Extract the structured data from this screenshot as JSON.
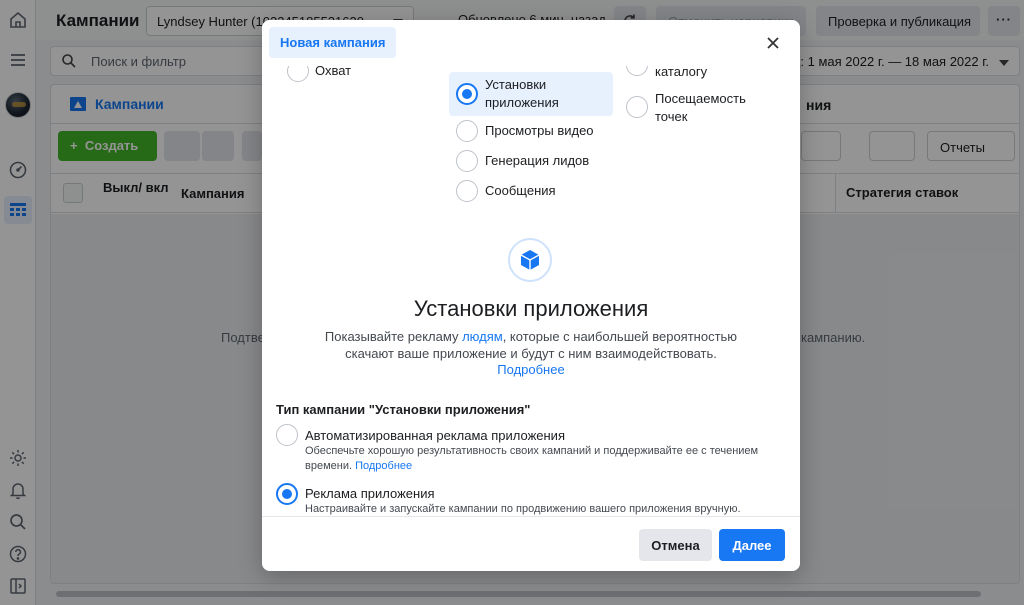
{
  "topbar": {
    "title": "Кампании",
    "account": "Lyndsey Hunter (102345185521630",
    "updated": "Обновлено 6 мин. назад",
    "discard_label": "Отменить черновики",
    "publish_label": "Проверка и публикация",
    "more_label": "···"
  },
  "search": {
    "placeholder": "Поиск и фильтр",
    "date_range": "ц: 1 мая 2022 г. — 18 мая 2022 г."
  },
  "panel": {
    "tab_campaigns": "Кампании",
    "tab_right": "ния",
    "create_label": "Создать",
    "reports_label": "Отчеты",
    "col_onoff": "Выкл/ вкл",
    "col_campaign": "Кампания",
    "col_bid": "Стратегия ставок",
    "empty_left": "Подтве",
    "empty_right": "кампанию."
  },
  "modal": {
    "chip": "Новая кампания",
    "objectives": {
      "reach": "Охват",
      "app_installs": "Установки приложения",
      "video_views": "Просмотры видео",
      "lead_gen": "Генерация лидов",
      "messages": "Сообщения",
      "catalog": "каталогу",
      "store_traffic": "Посещаемость точек"
    },
    "detail": {
      "title": "Установки приложения",
      "desc_before": "Показывайте рекламу ",
      "desc_link": "людям",
      "desc_after": ", которые с наибольшей вероятностью скачают ваше приложение и будут с ним взаимодействовать.",
      "more": "Подробнее"
    },
    "type_header": "Тип кампании \"Установки приложения\"",
    "types": [
      {
        "name": "Автоматизированная реклама приложения",
        "desc": "Обеспечьте хорошую результативность своих кампаний и поддерживайте ее с течением времени. ",
        "link": "Подробнее",
        "selected": false
      },
      {
        "name": "Реклама приложения",
        "desc": "Настраивайте и запускайте кампании по продвижению вашего приложения вручную.",
        "link": "",
        "selected": true
      }
    ],
    "cancel_label": "Отмена",
    "next_label": "Далее"
  },
  "colors": {
    "accent": "#1877f2",
    "create_green": "#42b72a",
    "selected_bg": "#e7f0fd"
  }
}
